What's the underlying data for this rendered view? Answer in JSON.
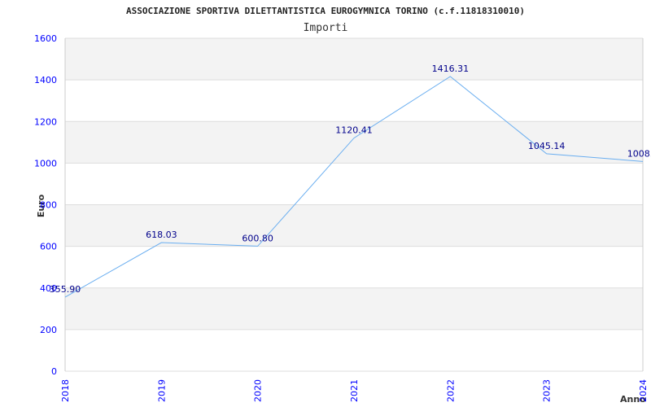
{
  "chart_data": {
    "type": "line",
    "title": "ASSOCIAZIONE SPORTIVA DILETTANTISTICA EUROGYMNICA TORINO (c.f.11818310010)",
    "subtitle": "Importi",
    "xlabel": "Anno",
    "ylabel": "Euro",
    "ylim": [
      0,
      1600
    ],
    "yticks": [
      0,
      200,
      400,
      600,
      800,
      1000,
      1200,
      1400,
      1600
    ],
    "categories": [
      "2018",
      "2019",
      "2020",
      "2021",
      "2022",
      "2023",
      "2024"
    ],
    "values": [
      355.9,
      618.03,
      600.8,
      1120.41,
      1416.31,
      1045.14,
      1008.0
    ],
    "data_labels": [
      "355.90",
      "618.03",
      "600.80",
      "1120.41",
      "1416.31",
      "1045.14",
      "1008.0"
    ],
    "grid": true,
    "colors": {
      "line": "#6aaef0",
      "tick_labels": "#0000ff",
      "data_labels": "#00008b",
      "band": "#f3f3f3",
      "grid": "#dddddd"
    }
  }
}
